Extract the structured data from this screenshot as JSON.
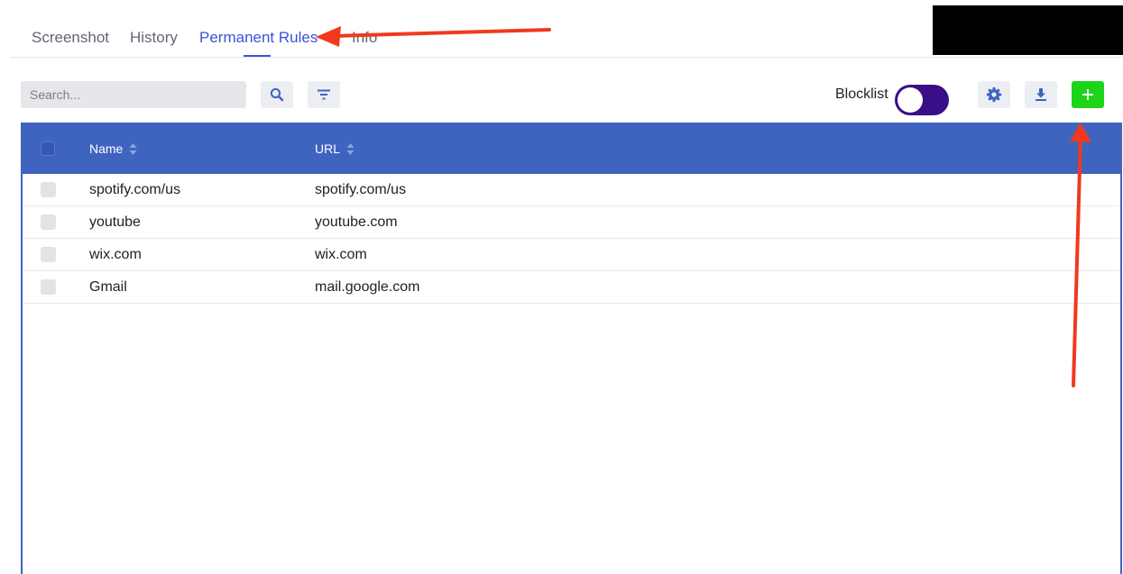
{
  "tabs": [
    {
      "label": "Screenshot",
      "active": false
    },
    {
      "label": "History",
      "active": false
    },
    {
      "label": "Permanent Rules",
      "active": true
    },
    {
      "label": "Info",
      "active": false
    }
  ],
  "toolbar": {
    "search_placeholder": "Search...",
    "blocklist_label": "Blocklist",
    "blocklist_enabled": true,
    "icons": {
      "search": "search-icon",
      "filter": "filter-icon",
      "settings": "gear-icon",
      "download": "download-icon",
      "add": "plus-icon"
    }
  },
  "table": {
    "columns": [
      {
        "label": "Name"
      },
      {
        "label": "URL"
      }
    ],
    "rows": [
      {
        "name": "spotify.com/us",
        "url": "spotify.com/us"
      },
      {
        "name": "youtube",
        "url": "youtube.com"
      },
      {
        "name": "wix.com",
        "url": "wix.com"
      },
      {
        "name": "Gmail",
        "url": "mail.google.com"
      }
    ]
  },
  "colors": {
    "accent": "#3f51d6",
    "header": "#3e64bf",
    "toggle": "#3a0e86",
    "add_button": "#1ed41a",
    "annotation_arrow": "#f0391e"
  }
}
